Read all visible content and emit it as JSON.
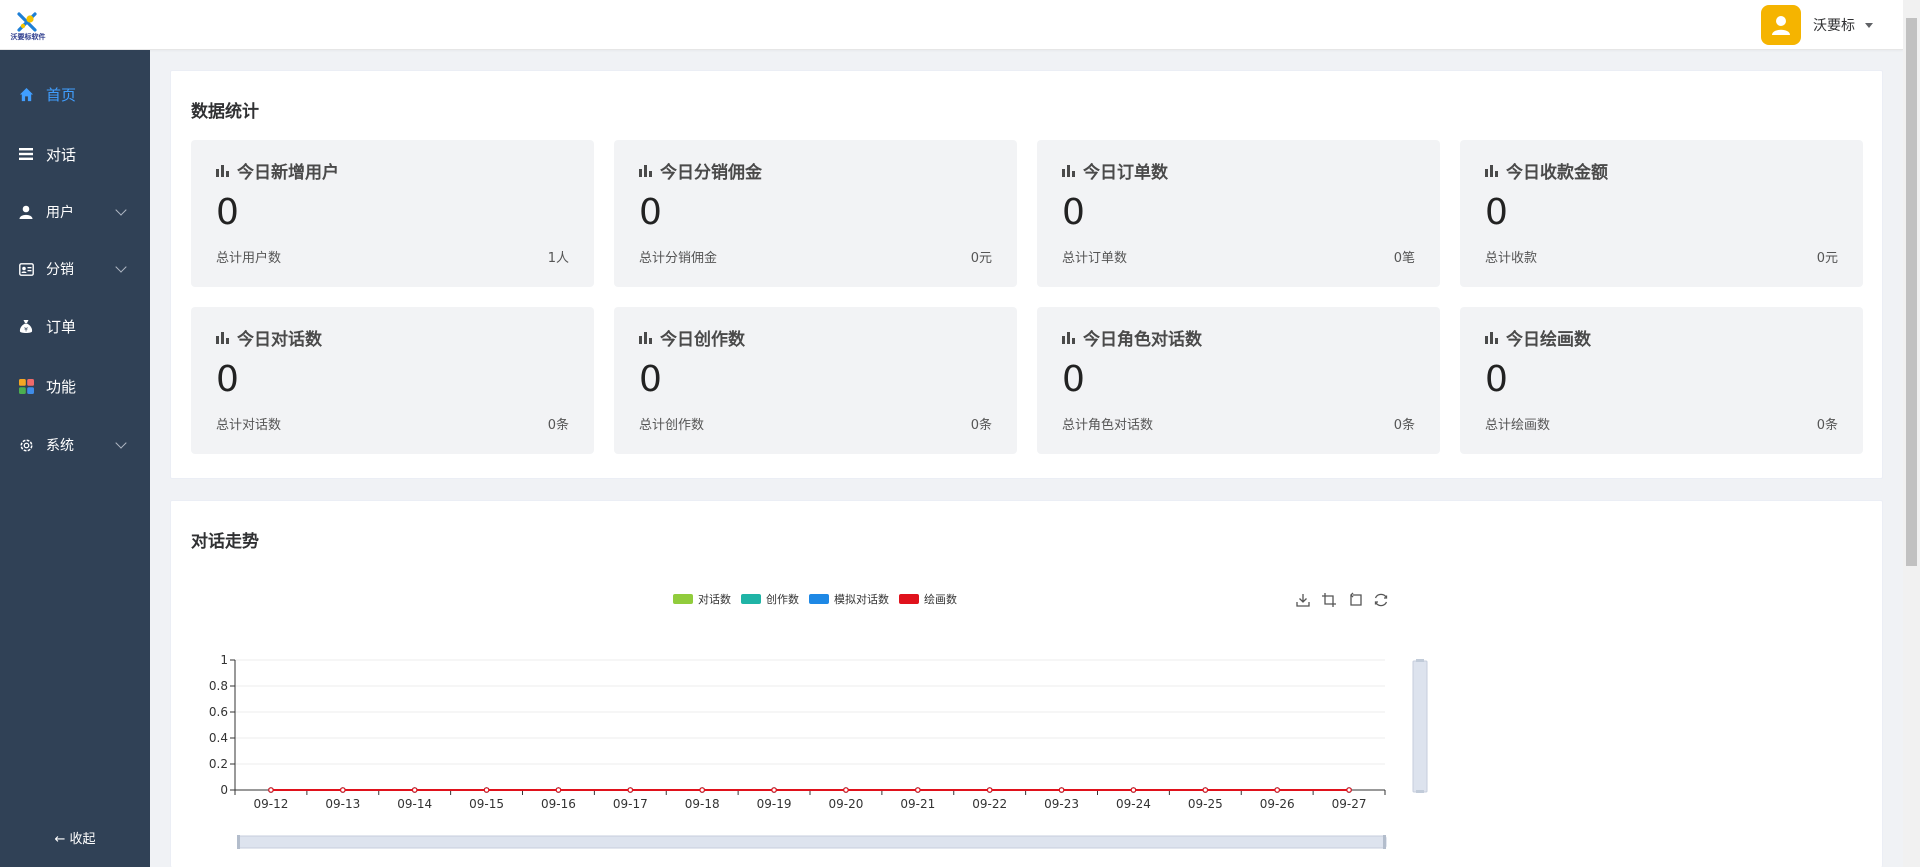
{
  "header": {
    "logo_text": "沃要标软件",
    "user_name": "沃要标"
  },
  "sidebar": {
    "items": [
      {
        "label": "首页",
        "icon": "home-icon",
        "active": true,
        "has_children": false
      },
      {
        "label": "对话",
        "icon": "list-icon",
        "active": false,
        "has_children": false
      },
      {
        "label": "用户",
        "icon": "user-icon",
        "active": false,
        "has_children": true
      },
      {
        "label": "分销",
        "icon": "id-card-icon",
        "active": false,
        "has_children": true
      },
      {
        "label": "订单",
        "icon": "money-bag-icon",
        "active": false,
        "has_children": false
      },
      {
        "label": "功能",
        "icon": "apps-icon",
        "active": false,
        "has_children": false
      },
      {
        "label": "系统",
        "icon": "gear-icon",
        "active": false,
        "has_children": true
      }
    ],
    "collapse_label": "收起"
  },
  "stats_panel": {
    "title": "数据统计",
    "cards": [
      {
        "title": "今日新增用户",
        "value": "0",
        "sub_label": "总计用户数",
        "total": "1人"
      },
      {
        "title": "今日分销佣金",
        "value": "0",
        "sub_label": "总计分销佣金",
        "total": "0元"
      },
      {
        "title": "今日订单数",
        "value": "0",
        "sub_label": "总计订单数",
        "total": "0笔"
      },
      {
        "title": "今日收款金额",
        "value": "0",
        "sub_label": "总计收款",
        "total": "0元"
      },
      {
        "title": "今日对话数",
        "value": "0",
        "sub_label": "总计对话数",
        "total": "0条"
      },
      {
        "title": "今日创作数",
        "value": "0",
        "sub_label": "总计创作数",
        "total": "0条"
      },
      {
        "title": "今日角色对话数",
        "value": "0",
        "sub_label": "总计角色对话数",
        "total": "0条"
      },
      {
        "title": "今日绘画数",
        "value": "0",
        "sub_label": "总计绘画数",
        "total": "0条"
      }
    ]
  },
  "trend_panel": {
    "title": "对话走势"
  },
  "colors": {
    "sidebar_bg": "#304156",
    "active": "#409eff",
    "series": [
      "#91cc3c",
      "#1fb4a6",
      "#1e88e5",
      "#e0121c"
    ]
  },
  "chart_data": {
    "type": "line",
    "x": [
      "09-12",
      "09-13",
      "09-14",
      "09-15",
      "09-16",
      "09-17",
      "09-18",
      "09-19",
      "09-20",
      "09-21",
      "09-22",
      "09-23",
      "09-24",
      "09-25",
      "09-26",
      "09-27"
    ],
    "series": [
      {
        "name": "对话数",
        "values": [
          0,
          0,
          0,
          0,
          0,
          0,
          0,
          0,
          0,
          0,
          0,
          0,
          0,
          0,
          0,
          0
        ]
      },
      {
        "name": "创作数",
        "values": [
          0,
          0,
          0,
          0,
          0,
          0,
          0,
          0,
          0,
          0,
          0,
          0,
          0,
          0,
          0,
          0
        ]
      },
      {
        "name": "模拟对话数",
        "values": [
          0,
          0,
          0,
          0,
          0,
          0,
          0,
          0,
          0,
          0,
          0,
          0,
          0,
          0,
          0,
          0
        ]
      },
      {
        "name": "绘画数",
        "values": [
          0,
          0,
          0,
          0,
          0,
          0,
          0,
          0,
          0,
          0,
          0,
          0,
          0,
          0,
          0,
          0
        ]
      }
    ],
    "y_ticks": [
      "0",
      "0.2",
      "0.4",
      "0.6",
      "0.8",
      "1"
    ],
    "ylim": [
      0,
      1
    ],
    "grid": true,
    "legend_position": "top-center",
    "toolbox": [
      "download-icon",
      "crop-icon",
      "crop-reset-icon",
      "refresh-icon"
    ]
  }
}
